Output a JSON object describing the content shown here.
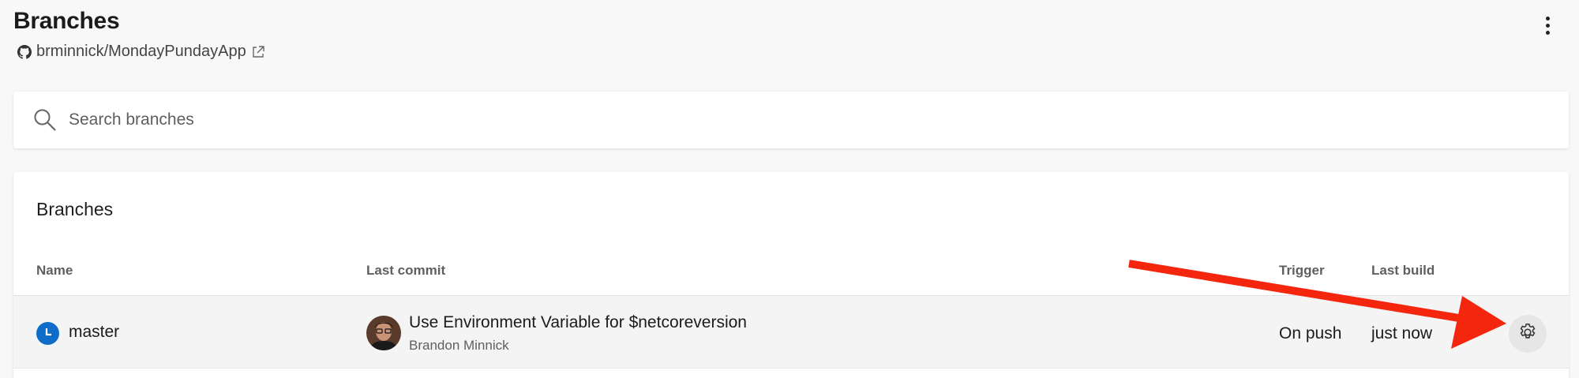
{
  "header": {
    "title": "Branches",
    "repo_name": "brminnick/MondayPundayApp",
    "repo_icon": "github-icon",
    "external_link_icon": "external-link-icon",
    "more_icon": "more-vertical-icon"
  },
  "search": {
    "placeholder": "Search branches",
    "value": ""
  },
  "branches_card": {
    "title": "Branches",
    "columns": {
      "name": "Name",
      "last_commit": "Last commit",
      "trigger": "Trigger",
      "last_build": "Last build"
    },
    "rows": [
      {
        "branch": "master",
        "commit_message": "Use Environment Variable for $netcoreversion",
        "commit_author": "Brandon Minnick",
        "trigger": "On push",
        "last_build": "just now",
        "status_icon": "clock-icon",
        "status_color": "#0f6cc9",
        "action_icon": "gear-icon"
      }
    ]
  },
  "annotation": {
    "type": "arrow",
    "color": "#f4260d",
    "points_to": "gear-button"
  }
}
